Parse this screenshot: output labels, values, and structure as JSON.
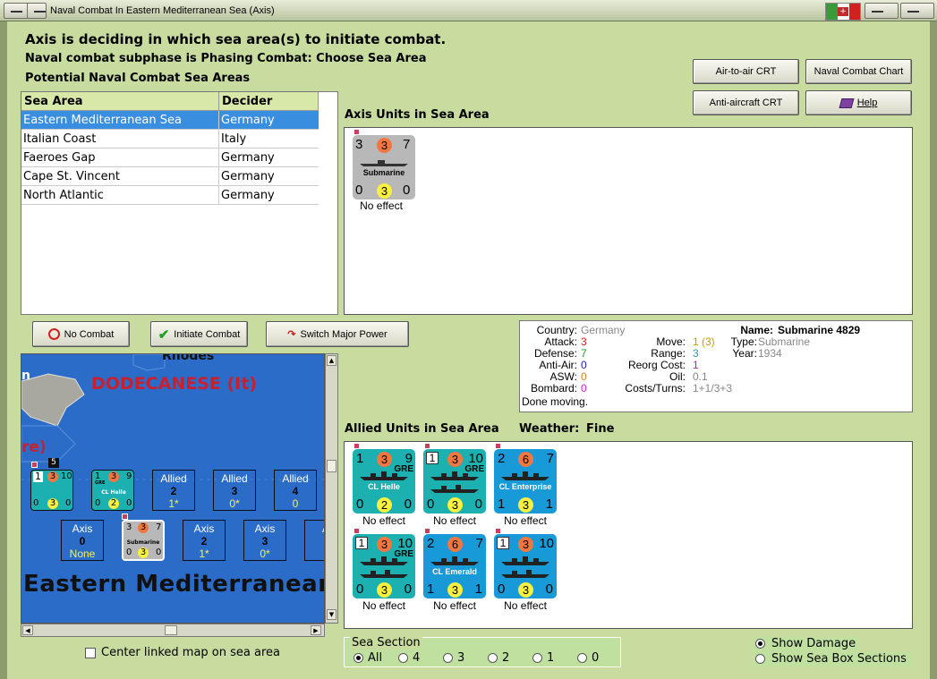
{
  "window": {
    "title": "Naval Combat In Eastern Mediterranean Sea (Axis)"
  },
  "messages": {
    "line1": "Axis is deciding in which sea area(s) to initiate combat.",
    "line2": "Naval combat subphase is Phasing Combat: Choose Sea Area",
    "line3": "Potential Naval Combat Sea Areas"
  },
  "buttons": {
    "air_to_air": "Air-to-air CRT",
    "naval_combat_chart": "Naval Combat Chart",
    "anti_aircraft": "Anti-aircraft CRT",
    "help": "Help",
    "no_combat": "No Combat",
    "initiate_combat": "Initiate Combat",
    "switch_major_power": "Switch Major Power"
  },
  "sea_table": {
    "headers": [
      "Sea Area",
      "Decider"
    ],
    "rows": [
      {
        "area": "Eastern Mediterranean Sea",
        "decider": "Germany"
      },
      {
        "area": "Italian Coast",
        "decider": "Italy"
      },
      {
        "area": "Faeroes Gap",
        "decider": "Germany"
      },
      {
        "area": "Cape St. Vincent",
        "decider": "Germany"
      },
      {
        "area": "North Atlantic",
        "decider": "Germany"
      }
    ]
  },
  "axis_units": {
    "title": "Axis Units in Sea Area",
    "units": [
      {
        "name": "Submarine",
        "tl": "3",
        "tc": "3",
        "tr": "7",
        "bl": "0",
        "bc": "3",
        "br": "0",
        "status": "No effect"
      }
    ]
  },
  "info": {
    "country_label": "Country:",
    "country": "Germany",
    "attack_label": "Attack:",
    "attack": "3",
    "defense_label": "Defense:",
    "defense": "7",
    "antiair_label": "Anti-Air:",
    "antiair": "0",
    "asw_label": "ASW:",
    "asw": "0",
    "bombard_label": "Bombard:",
    "bombard": "0",
    "status": "Done moving.",
    "name_label": "Name:",
    "name": "Submarine 4829",
    "move_label": "Move:",
    "move": "1",
    "move_extra": "(3)",
    "type_label": "Type:",
    "type": "Submarine",
    "range_label": "Range:",
    "range": "3",
    "year_label": "Year:",
    "year": "1934",
    "reorg_label": "Reorg Cost:",
    "reorg": "1",
    "oil_label": "Oil:",
    "oil": "0.1",
    "costs_label": "Costs/Turns:",
    "costs": "1+1/3+3"
  },
  "allied": {
    "title": "Allied Units in Sea Area",
    "weather_label": "Weather:",
    "weather": "Fine",
    "units": [
      {
        "name": "CL Helle",
        "tl": "1",
        "tc": "3",
        "tr": "9",
        "tag": "GRE",
        "bl": "0",
        "bc": "2",
        "br": "0",
        "color": "teal",
        "status": "No effect",
        "boxed": false
      },
      {
        "name": "",
        "tl": "1",
        "tc": "3",
        "tr": "10",
        "tag": "GRE",
        "bl": "0",
        "bc": "3",
        "br": "0",
        "color": "teal",
        "status": "No effect",
        "boxed": true
      },
      {
        "name": "CL Enterprise",
        "tl": "2",
        "tc": "6",
        "tr": "7",
        "tag": "",
        "bl": "1",
        "bc": "3",
        "br": "1",
        "color": "blue",
        "status": "No effect",
        "boxed": false
      },
      {
        "name": "",
        "tl": "1",
        "tc": "3",
        "tr": "10",
        "tag": "GRE",
        "bl": "0",
        "bc": "3",
        "br": "0",
        "color": "teal",
        "status": "No effect",
        "boxed": true
      },
      {
        "name": "CL Emerald",
        "tl": "2",
        "tc": "6",
        "tr": "7",
        "tag": "",
        "bl": "1",
        "bc": "3",
        "br": "1",
        "color": "blue",
        "status": "No effect",
        "boxed": false
      },
      {
        "name": "",
        "tl": "1",
        "tc": "3",
        "tr": "10",
        "tag": "",
        "bl": "0",
        "bc": "3",
        "br": "0",
        "color": "blue",
        "status": "No effect",
        "boxed": true
      }
    ]
  },
  "map": {
    "label_rhodes": "Rhodes",
    "label_dodecanese": "DODECANESE (It)",
    "label_re": "re)",
    "label_n": "n",
    "label_sea": "Eastern Mediterranean",
    "stack_count": "5",
    "allied_boxes": [
      {
        "label": "Allied",
        "num": "2",
        "sub": "1*"
      },
      {
        "label": "Allied",
        "num": "3",
        "sub": "0*"
      },
      {
        "label": "Allied",
        "num": "4",
        "sub": "0"
      }
    ],
    "axis_boxes": [
      {
        "label": "Axis",
        "num": "0",
        "sub": "None"
      },
      {
        "label": "Axis",
        "num": "2",
        "sub": "1*"
      },
      {
        "label": "Axis",
        "num": "3",
        "sub": "0*"
      },
      {
        "label": "A",
        "num": "",
        "sub": ""
      }
    ],
    "counter1": {
      "tl": "1",
      "tc": "3",
      "tr": "10",
      "bl": "0",
      "bc": "3",
      "br": "0"
    },
    "counter2": {
      "tl": "1",
      "tc": "3",
      "tr": "9",
      "name": "CL Helle",
      "tag": "GRE",
      "bl": "0",
      "bc": "2",
      "br": "0"
    },
    "counter3": {
      "tl": "3",
      "tc": "3",
      "tr": "7",
      "name": "Submarine",
      "bl": "0",
      "bc": "3",
      "br": "0"
    },
    "center_link": "Center linked map on sea area"
  },
  "sea_section": {
    "title": "Sea Section",
    "options": [
      "All",
      "4",
      "3",
      "2",
      "1",
      "0"
    ],
    "selected": "All"
  },
  "show": {
    "damage": "Show Damage",
    "sections": "Show Sea Box Sections"
  },
  "colors": {
    "background": "#c8dca0",
    "selection": "#3a8ee0",
    "attack": "#d02020",
    "defense": "#20a020",
    "antiair": "#2020c0",
    "asw": "#e08020",
    "bombard": "#d020d0",
    "move": "#c0a000",
    "reorg": "#c020c0"
  }
}
